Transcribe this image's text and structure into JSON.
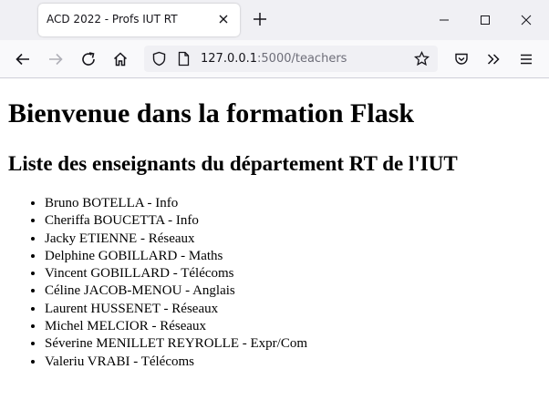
{
  "browser": {
    "tab_title": "ACD 2022 - Profs IUT RT",
    "url_host": "127.0.0.1",
    "url_path": ":5000/teachers"
  },
  "page": {
    "heading": "Bienvenue dans la formation Flask",
    "subheading": "Liste des enseignants du département RT de l'IUT",
    "teachers": [
      "Bruno BOTELLA - Info",
      "Cheriffa BOUCETTA - Info",
      "Jacky ETIENNE - Réseaux",
      "Delphine GOBILLARD - Maths",
      "Vincent GOBILLARD - Télécoms",
      "Céline JACOB-MENOU - Anglais",
      "Laurent HUSSENET - Réseaux",
      "Michel MELCIOR - Réseaux",
      "Séverine MENILLET REYROLLE - Expr/Com",
      "Valeriu VRABI - Télécoms"
    ]
  },
  "icons": {
    "back": "arrow-left-icon",
    "forward": "arrow-right-icon",
    "reload": "reload-icon",
    "home": "home-icon",
    "shield": "shield-icon",
    "page": "page-icon",
    "bookmark": "star-icon",
    "pocket": "pocket-icon",
    "overflow": "chevron-double-right-icon",
    "menu": "hamburger-menu-icon"
  }
}
